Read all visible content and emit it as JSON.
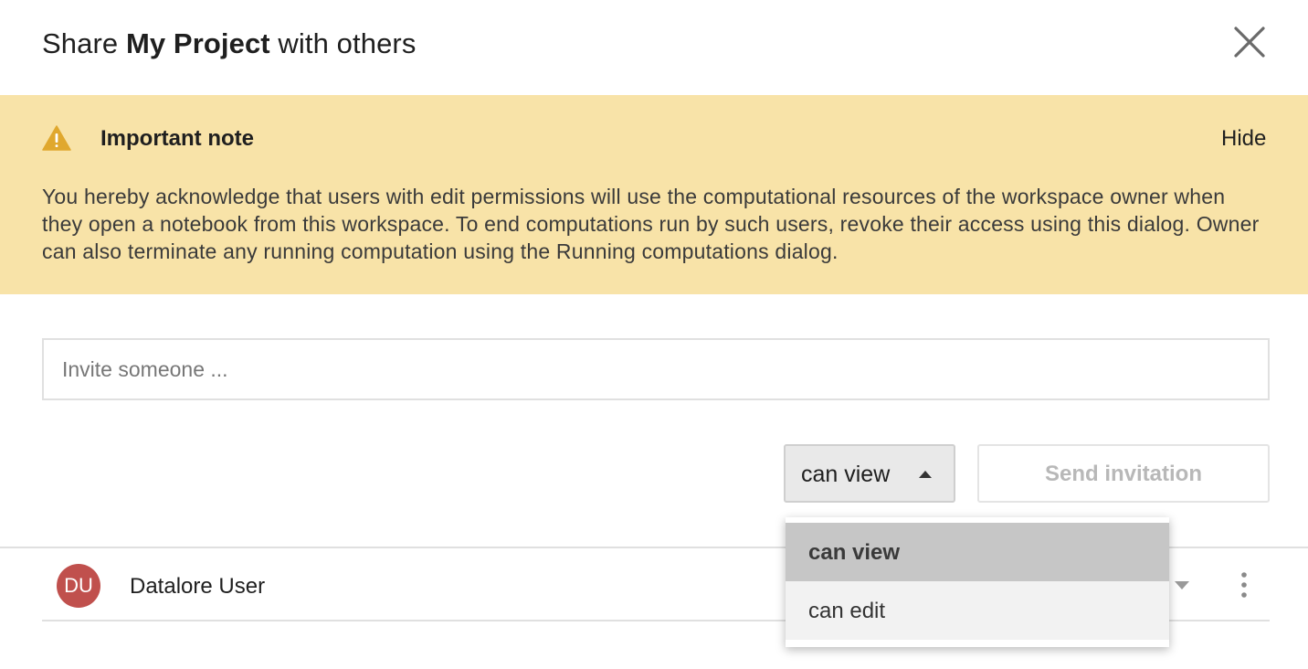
{
  "dialog": {
    "title_prefix": "Share ",
    "title_project": "My Project",
    "title_suffix": " with others",
    "close_icon": "close-icon"
  },
  "note": {
    "icon": "warning-icon",
    "title": "Important note",
    "hide_label": "Hide",
    "text": "You hereby acknowledge that users with edit permissions will use the computational resources of the workspace owner when they open a notebook from this workspace. To end computations run by such users, revoke their access using this dialog. Owner can also terminate any running computation using the Running computations dialog.",
    "background_color": "#f8e3a8",
    "icon_color": "#e0a82e"
  },
  "invite": {
    "placeholder": "Invite someone ...",
    "value": ""
  },
  "permission": {
    "selected": "can view",
    "options": [
      "can view",
      "can edit"
    ]
  },
  "send_button": {
    "label": "Send invitation"
  },
  "users": [
    {
      "initials": "DU",
      "name": "Datalore User",
      "avatar_color": "#c0504d"
    }
  ]
}
